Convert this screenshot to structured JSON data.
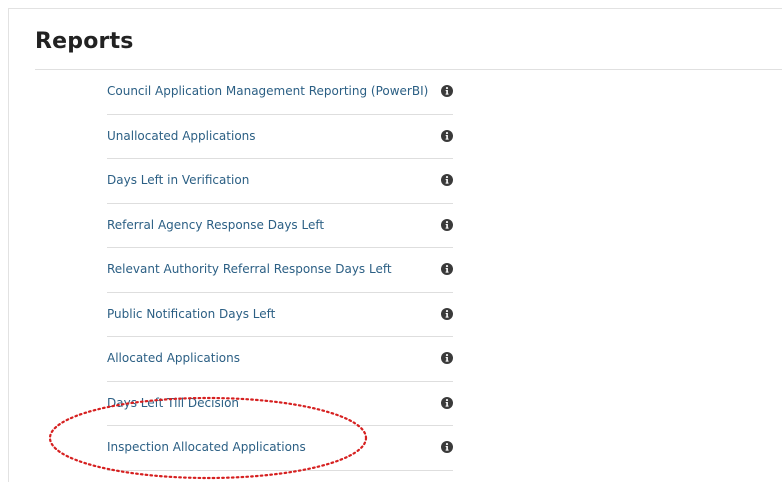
{
  "page": {
    "title": "Reports"
  },
  "reports": [
    {
      "label": "Council Application Management Reporting (PowerBI)",
      "icon": "info-icon"
    },
    {
      "label": "Unallocated Applications",
      "icon": "info-icon"
    },
    {
      "label": "Days Left in Verification",
      "icon": "info-icon"
    },
    {
      "label": "Referral Agency Response Days Left",
      "icon": "info-icon"
    },
    {
      "label": "Relevant Authority Referral Response Days Left",
      "icon": "info-icon"
    },
    {
      "label": "Public Notification Days Left",
      "icon": "info-icon"
    },
    {
      "label": "Allocated Applications",
      "icon": "info-icon"
    },
    {
      "label": "Days Left Till Decision",
      "icon": "info-icon"
    },
    {
      "label": "Inspection Allocated Applications",
      "icon": "info-icon"
    }
  ],
  "colors": {
    "link": "#2b5f84",
    "icon": "#3a3a3a",
    "divider": "#dedede",
    "highlight": "#d62020"
  }
}
